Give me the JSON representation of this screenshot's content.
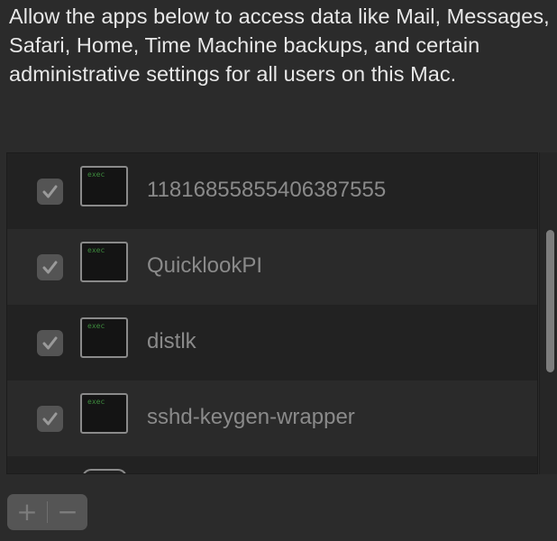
{
  "description": "Allow the apps below to access data like Mail, Messages, Safari, Home, Time Machine backups, and certain administrative settings for all users on this Mac.",
  "apps": [
    {
      "name": "1181685585540638755​5",
      "icon_label": "exec",
      "checked": true
    },
    {
      "name": "QuicklookPI",
      "icon_label": "exec",
      "checked": true
    },
    {
      "name": "distlk",
      "icon_label": "exec",
      "checked": true
    },
    {
      "name": "sshd-keygen-wrapper",
      "icon_label": "exec",
      "checked": true
    }
  ],
  "controls": {
    "add_label": "+",
    "remove_label": "−"
  },
  "colors": {
    "background": "#2b2b2b",
    "row_dark": "#222222",
    "row_light": "#2a2a2a",
    "exec_text": "#3d8a3d"
  }
}
